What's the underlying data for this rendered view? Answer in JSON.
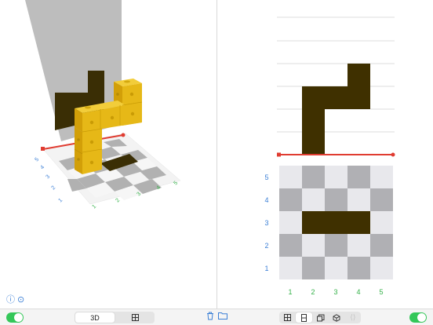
{
  "left_pane": {
    "row_labels": [
      "5",
      "4",
      "3",
      "2",
      "1"
    ],
    "col_labels": [
      "1",
      "2",
      "3",
      "4",
      "5"
    ],
    "info_icon": "info-circle-icon",
    "more_icon": "more-circle-icon"
  },
  "right_pane": {
    "row_labels": [
      "5",
      "4",
      "3",
      "2",
      "1"
    ],
    "col_labels": [
      "1",
      "2",
      "3",
      "4",
      "5"
    ]
  },
  "toolbar": {
    "left_toggle_on": true,
    "view_segments": [
      {
        "label": "3D",
        "icon": "",
        "active": true
      },
      {
        "label": "",
        "icon": "grid-icon",
        "active": false
      }
    ],
    "trash_icon": "trash-icon",
    "folder_icon": "folder-icon",
    "tool_segments": [
      {
        "icon": "grid-icon",
        "active": false
      },
      {
        "icon": "column-icon",
        "active": true
      },
      {
        "icon": "layers-icon",
        "active": false
      },
      {
        "icon": "cube-icon",
        "active": false
      },
      {
        "icon": "brackets-icon",
        "active": false,
        "disabled": true
      }
    ],
    "right_toggle_on": true
  },
  "colors": {
    "accent": "#3b7fd6",
    "axis_red": "#e03c31",
    "cube_yellow": "#e6b817",
    "shadow_dark": "#3f3000",
    "green_label": "#36b24a",
    "toggle_green": "#34c759"
  }
}
